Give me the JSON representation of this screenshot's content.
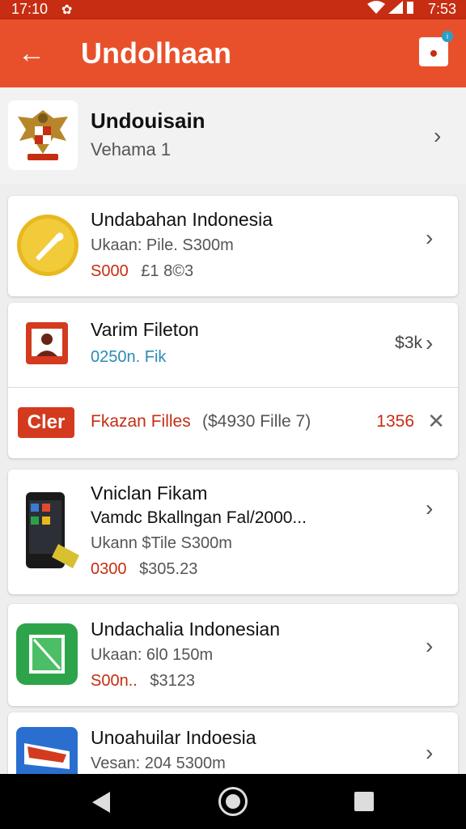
{
  "status_bar": {
    "time_left": "17:10",
    "time_right": "7:53"
  },
  "app_bar": {
    "title": "Undolhaan",
    "badge": "i"
  },
  "header_item": {
    "title": "Undouisain",
    "subtitle": "Vehama 1"
  },
  "items": [
    {
      "title": "Undabahan Indonesia",
      "subtitle": "Ukaan: Pile. S300m",
      "price_red": "S000",
      "price_grey": "£1 8©3"
    },
    {
      "title": "Varim Fileton",
      "subtitle": "0250n. Fik",
      "trailing": "$3k"
    },
    {
      "logo_text": "Cler",
      "title": "Fkazan Filles",
      "detail": "($4930  Fille 7)",
      "trailing": "1356"
    },
    {
      "title": "Vniclan Fikam",
      "line2": "Vamdc Bkallngan Fal/2000...",
      "subtitle": "Ukann $Tile S300m",
      "price_red": "0300",
      "price_grey": "$305.23"
    },
    {
      "title": "Undachalia Indonesian",
      "subtitle": "Ukaan: 6l0 150m",
      "price_red": "S00n..",
      "price_grey": "$3123"
    },
    {
      "title": "Unoahuilar Indoesia",
      "subtitle": "Vesan: 204 5300m"
    }
  ],
  "colors": {
    "appbar": "#e8502c",
    "statusbar": "#c62d12",
    "accent_red": "#c62d12",
    "accent_blue": "#2a8ab8"
  }
}
